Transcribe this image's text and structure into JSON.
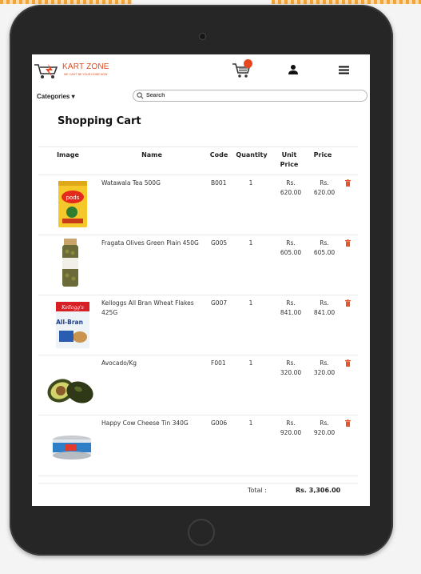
{
  "header": {
    "logo_title": "KART ZONE",
    "logo_tagline": "WE CAN'T BE YOUR HOME NOW",
    "cart_icon": "cart-icon",
    "user_icon": "user-icon",
    "menu_icon": "hamburger-icon"
  },
  "subbar": {
    "categories_label": "Categories ▾",
    "search_placeholder": "Search"
  },
  "page_title": "Shopping Cart",
  "columns": {
    "image": "Image",
    "name": "Name",
    "code": "Code",
    "quantity": "Quantity",
    "unit_price": "Unit\nPrice",
    "price": "Price"
  },
  "items": [
    {
      "name": "Watawala Tea 500G",
      "code": "B001",
      "qty": "1",
      "unit_price": "Rs.\n620.00",
      "price": "Rs.\n620.00"
    },
    {
      "name": "Fragata Olives Green Plain 450G",
      "code": "G005",
      "qty": "1",
      "unit_price": "Rs.\n605.00",
      "price": "Rs.\n605.00"
    },
    {
      "name": "Kelloggs All Bran Wheat Flakes 425G",
      "code": "G007",
      "qty": "1",
      "unit_price": "Rs.\n841.00",
      "price": "Rs.\n841.00"
    },
    {
      "name": "Avocado/Kg",
      "code": "F001",
      "qty": "1",
      "unit_price": "Rs.\n320.00",
      "price": "Rs.\n320.00"
    },
    {
      "name": "Happy Cow Cheese Tin 340G",
      "code": "G006",
      "qty": "1",
      "unit_price": "Rs.\n920.00",
      "price": "Rs.\n920.00"
    }
  ],
  "product_image_text": {
    "tea": "pods",
    "cereal_brand": "Kellogg's",
    "cereal_name": "All-Bran"
  },
  "footer": {
    "total_label": "Total :",
    "total_value": "Rs. 3,306.00"
  },
  "colors": {
    "accent": "#e8461e",
    "delete": "#e4572e"
  }
}
